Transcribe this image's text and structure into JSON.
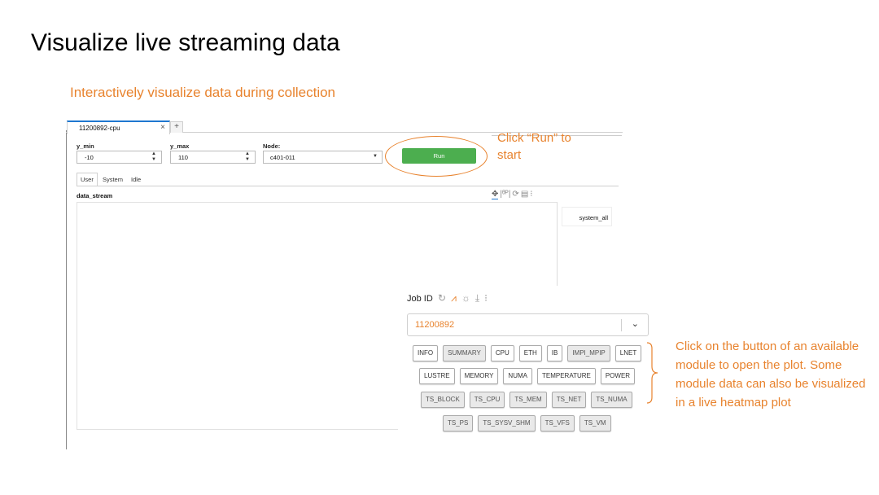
{
  "slide": {
    "title": "Visualize live streaming data",
    "subtitle": "Interactively visualize data during collection",
    "run_note": "Click “Run” to start",
    "module_note": "Click on the button of an available module to open the plot. Some module data can also be visualized in a live heatmap plot"
  },
  "notebook": {
    "tab_label": "11200892-cpu",
    "tab_close": "×",
    "tab_add": "+",
    "controls": {
      "ymin_label": "y_min",
      "ymin_value": "-10",
      "ymax_label": "y_max",
      "ymax_value": "110",
      "node_label": "Node:",
      "node_value": "c401-011",
      "run_label": "Run"
    },
    "subtabs": [
      "User",
      "System",
      "Idle"
    ],
    "plot_title": "data_stream",
    "legend_label": "system_all",
    "toolbar_icons": [
      "pan-icon",
      "zoom-icon",
      "reset-icon",
      "save-icon",
      "more-icon"
    ]
  },
  "job_panel": {
    "label": "Job ID",
    "icons": [
      "refresh-icon",
      "chart-icon",
      "theme-icon",
      "download-icon",
      "more-vertical-icon"
    ],
    "selected_job": "11200892",
    "module_rows": [
      [
        {
          "label": "INFO",
          "enabled": true
        },
        {
          "label": "SUMMARY",
          "enabled": false
        },
        {
          "label": "CPU",
          "enabled": true
        },
        {
          "label": "ETH",
          "enabled": true
        },
        {
          "label": "IB",
          "enabled": true
        },
        {
          "label": "IMPI_MPIP",
          "enabled": false
        },
        {
          "label": "LNET",
          "enabled": true
        }
      ],
      [
        {
          "label": "LUSTRE",
          "enabled": true
        },
        {
          "label": "MEMORY",
          "enabled": true
        },
        {
          "label": "NUMA",
          "enabled": true
        },
        {
          "label": "TEMPERATURE",
          "enabled": true
        },
        {
          "label": "POWER",
          "enabled": true
        }
      ],
      [
        {
          "label": "TS_BLOCK",
          "enabled": false
        },
        {
          "label": "TS_CPU",
          "enabled": false
        },
        {
          "label": "TS_MEM",
          "enabled": false
        },
        {
          "label": "TS_NET",
          "enabled": false
        },
        {
          "label": "TS_NUMA",
          "enabled": false
        }
      ],
      [
        {
          "label": "TS_PS",
          "enabled": false
        },
        {
          "label": "TS_SYSV_SHM",
          "enabled": false
        },
        {
          "label": "TS_VFS",
          "enabled": false
        },
        {
          "label": "TS_VM",
          "enabled": false
        }
      ]
    ]
  },
  "colors": {
    "accent": "#e8832e",
    "run_button": "#4cae4f",
    "tab_highlight": "#1f77d0"
  }
}
